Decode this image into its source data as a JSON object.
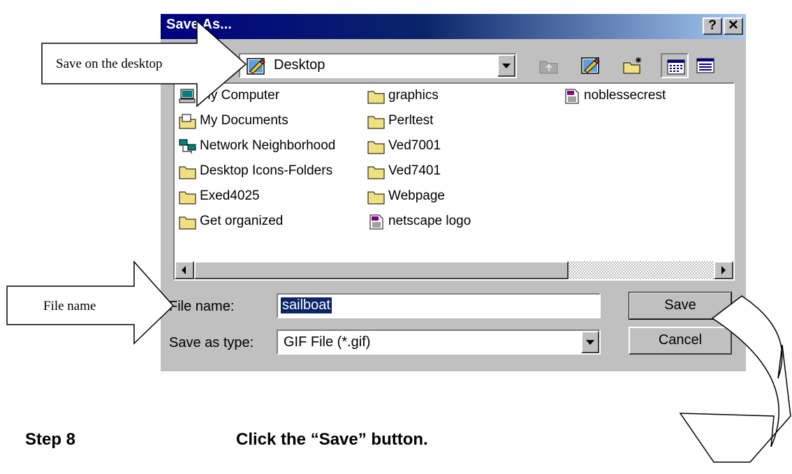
{
  "dialog": {
    "title": "Save As...",
    "help_button": "?",
    "close_button": "✕"
  },
  "save_in": {
    "value": "Desktop"
  },
  "file_list": {
    "items": [
      {
        "label": "My Computer",
        "icon": "my-computer-icon"
      },
      {
        "label": "My Documents",
        "icon": "my-documents-icon"
      },
      {
        "label": "Network Neighborhood",
        "icon": "network-neighborhood-icon"
      },
      {
        "label": "Desktop Icons-Folders",
        "icon": "folder-icon"
      },
      {
        "label": "Exed4025",
        "icon": "folder-icon"
      },
      {
        "label": "Get organized",
        "icon": "folder-icon"
      },
      {
        "label": "graphics",
        "icon": "folder-icon"
      },
      {
        "label": "Perltest",
        "icon": "folder-icon"
      },
      {
        "label": "Ved7001",
        "icon": "folder-icon"
      },
      {
        "label": "Ved7401",
        "icon": "folder-icon"
      },
      {
        "label": "Webpage",
        "icon": "folder-icon"
      },
      {
        "label": "netscape logo",
        "icon": "gif-file-icon"
      },
      {
        "label": "noblessecrest",
        "icon": "gif-file-icon"
      }
    ]
  },
  "form": {
    "file_name_label": "File name:",
    "file_name_value": "sailboat",
    "save_as_type_label": "Save as type:",
    "save_as_type_value": "GIF File (*.gif)"
  },
  "buttons": {
    "save": "Save",
    "cancel": "Cancel"
  },
  "annotations": {
    "callout_desktop": "Save on the desktop",
    "callout_file_name": "File name",
    "step_number": "Step 8",
    "step_text": "Click the “Save” button."
  },
  "colors": {
    "titlebar": "#0a246a",
    "face": "#c0c0c0",
    "selection": "#0a246a"
  }
}
